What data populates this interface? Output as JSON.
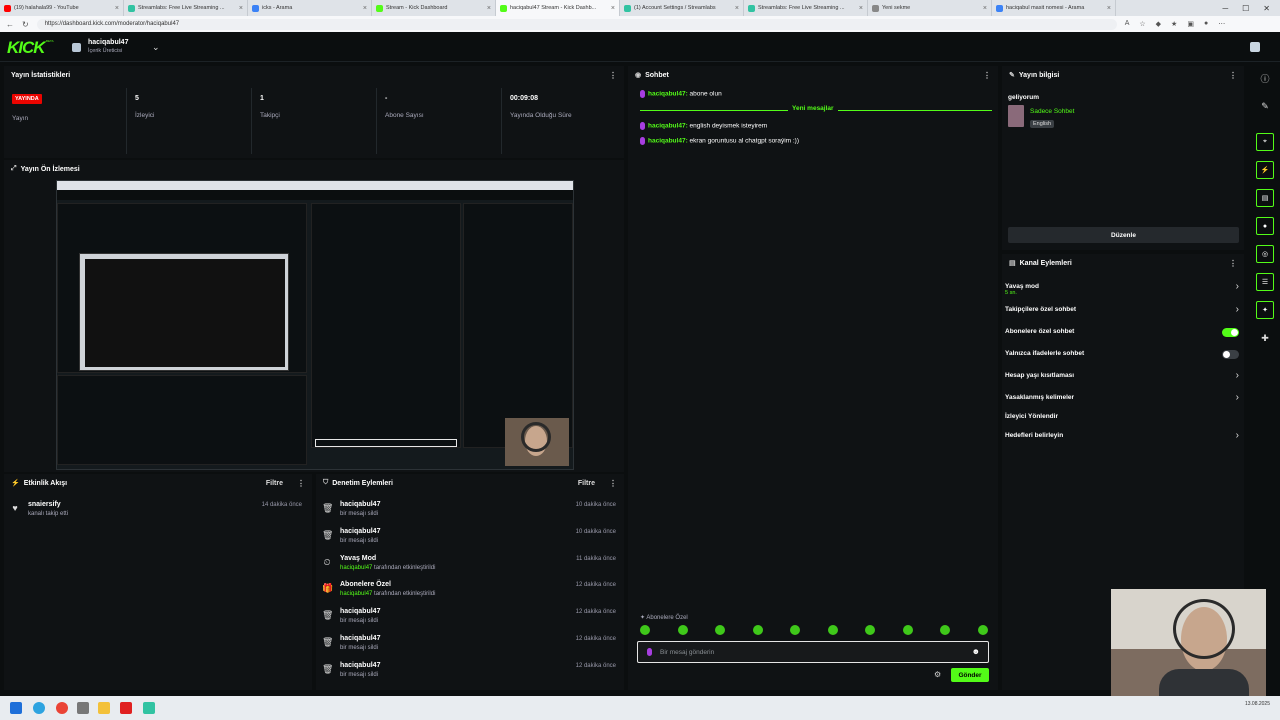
{
  "browser": {
    "tabs": [
      {
        "title": "(19) halahala99 - YouTube",
        "color": "#ff0000",
        "active": false
      },
      {
        "title": "Streamlabs: Free Live Streaming ...",
        "color": "#31c3a2",
        "active": false
      },
      {
        "title": "icks - Arama",
        "color": "#3b82f6",
        "active": false
      },
      {
        "title": "Stream - Kick Dashboard",
        "color": "#53fc18",
        "active": false
      },
      {
        "title": "haciqabul47 Stream - Kick Dashb...",
        "color": "#53fc18",
        "active": true
      },
      {
        "title": "(1) Account Settings / Streamlabs",
        "color": "#31c3a2",
        "active": false
      },
      {
        "title": "Streamlabs: Free Live Streaming ...",
        "color": "#31c3a2",
        "active": false
      },
      {
        "title": "Yeni sekme",
        "color": "#888888",
        "active": false
      },
      {
        "title": "haciqabul masit nomesi - Arama",
        "color": "#3b82f6",
        "active": false
      }
    ],
    "url": "https://dashboard.kick.com/moderator/haciqabul47",
    "taskbar_date": "13.08.2025"
  },
  "header": {
    "logo": "KICK",
    "logo_badge": "BETA",
    "channel_name": "haciqabul47",
    "channel_role": "İçerik Üreticisi"
  },
  "stats": {
    "title": "Yayın İstatistikleri",
    "live_badge": "YAYINDA",
    "items": [
      {
        "value": "",
        "label": "Yayın"
      },
      {
        "value": "5",
        "label": "İzleyici"
      },
      {
        "value": "1",
        "label": "Takipçi"
      },
      {
        "value": "-",
        "label": "Abone Sayısı"
      },
      {
        "value": "00:09:08",
        "label": "Yayında Olduğu Süre"
      }
    ]
  },
  "preview": {
    "title": "Yayın Ön İzlemesi"
  },
  "activity": {
    "title": "Etkinlik Akışı",
    "filter": "Filtre",
    "items": [
      {
        "name": "snaiersify",
        "sub": "kanalı takip etti",
        "time": "14 dakika önce"
      }
    ]
  },
  "moderation": {
    "title": "Denetim Eylemleri",
    "filter": "Filtre",
    "items": [
      {
        "name": "haciqabul47",
        "sub_user": "",
        "sub": "bir mesajı sildi",
        "time": "10 dakika önce",
        "icon": "trash"
      },
      {
        "name": "haciqabul47",
        "sub_user": "",
        "sub": "bir mesajı sildi",
        "time": "10 dakika önce",
        "icon": "trash"
      },
      {
        "name": "Yavaş Mod",
        "sub_user": "haciqabul47",
        "sub": " tarafından etkinleştirildi",
        "time": "11 dakika önce",
        "icon": "slow"
      },
      {
        "name": "Abonelere Özel",
        "sub_user": "haciqabul47",
        "sub": " tarafından etkinleştirildi",
        "time": "12 dakika önce",
        "icon": "gift"
      },
      {
        "name": "haciqabul47",
        "sub_user": "",
        "sub": "bir mesajı sildi",
        "time": "12 dakika önce",
        "icon": "trash"
      },
      {
        "name": "haciqabul47",
        "sub_user": "",
        "sub": "bir mesajı sildi",
        "time": "12 dakika önce",
        "icon": "trash"
      },
      {
        "name": "haciqabul47",
        "sub_user": "",
        "sub": "bir mesajı sildi",
        "time": "12 dakika önce",
        "icon": "trash"
      }
    ]
  },
  "chat": {
    "title": "Sohbet",
    "messages_before": [
      {
        "user": "haciqabul47:",
        "text": " abone olun"
      }
    ],
    "new_messages_label": "Yeni mesajlar",
    "messages_after": [
      {
        "user": "haciqabul47:",
        "text": " english deyismek isteyirem"
      },
      {
        "user": "haciqabul47:",
        "text": " ekran goruntusu al chatgpt soraýim :))"
      }
    ],
    "mode_label": "Abonelere Özel",
    "placeholder": "Bir mesaj gönderin",
    "send_label": "Gönder",
    "emote_color": "#3fc81a"
  },
  "stream_info": {
    "title": "Yayın bilgisi",
    "stream_title": "geliyorum",
    "category": "Sadece Sohbet",
    "language": "English",
    "edit_label": "Düzenle"
  },
  "channel_actions": {
    "title": "Kanal Eylemleri",
    "items": [
      {
        "label": "Yavaş mod",
        "sub": "5 sn.",
        "control": "arrow"
      },
      {
        "label": "Takipçilere özel sohbet",
        "sub": "",
        "control": "arrow"
      },
      {
        "label": "Abonelere özel sohbet",
        "sub": "",
        "control": "toggle-on"
      },
      {
        "label": "Yalnızca ifadelerle sohbet",
        "sub": "",
        "control": "toggle-off"
      },
      {
        "label": "Hesap yaşı kısıtlaması",
        "sub": "",
        "control": "arrow"
      },
      {
        "label": "Yasaklanmış kelimeler",
        "sub": "",
        "control": "arrow"
      },
      {
        "label": "İzleyici Yönlendir",
        "sub": "",
        "control": "none"
      },
      {
        "label": "Hedefleri belirleyin",
        "sub": "",
        "control": "arrow"
      }
    ]
  },
  "colors": {
    "accent": "#53fc18",
    "live": "#eb0400",
    "panel": "#0f1214",
    "background": "#0b0e0f"
  }
}
